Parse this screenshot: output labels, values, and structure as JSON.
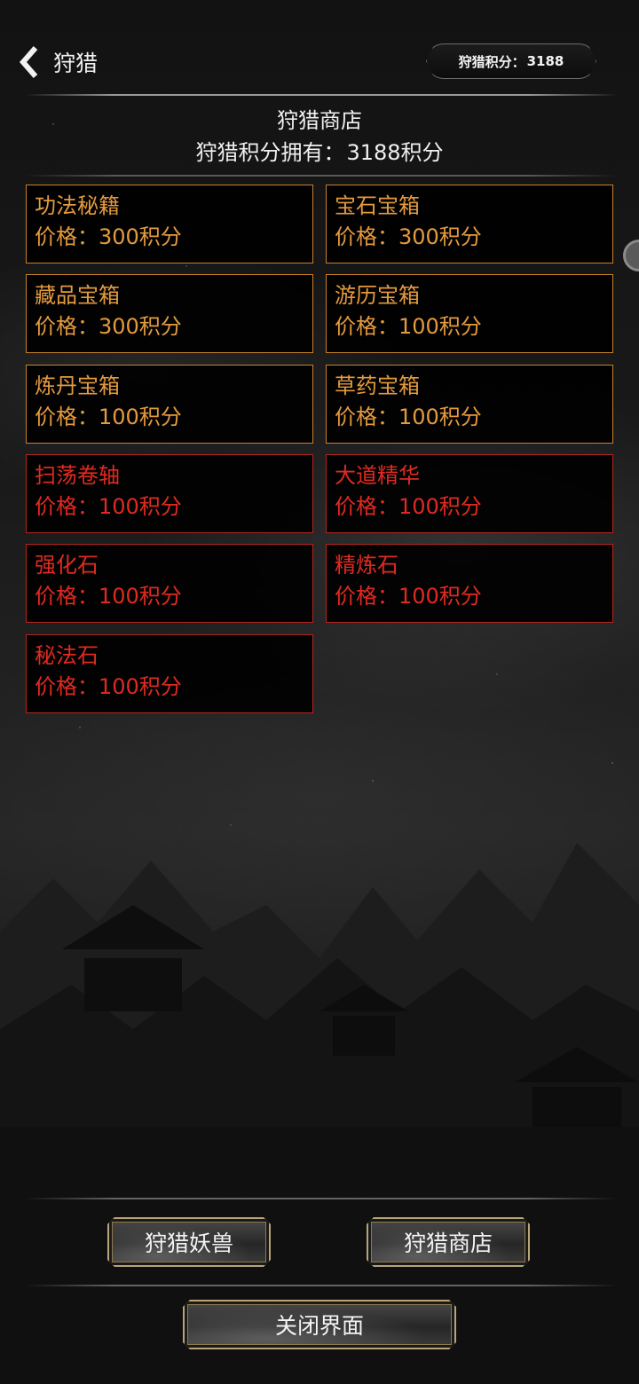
{
  "header": {
    "title": "狩猎",
    "score_label": "狩猎积分：",
    "score_value": "3188"
  },
  "shop": {
    "title": "狩猎商店",
    "points_label": "狩猎积分拥有：",
    "points_value": "3188积分"
  },
  "items": [
    {
      "name": "功法秘籍",
      "price": "价格：300积分",
      "color": "#e49a3e"
    },
    {
      "name": "宝石宝箱",
      "price": "价格：300积分",
      "color": "#e49a3e"
    },
    {
      "name": "藏品宝箱",
      "price": "价格：300积分",
      "color": "#e49a3e"
    },
    {
      "name": "游历宝箱",
      "price": "价格：100积分",
      "color": "#e49a3e"
    },
    {
      "name": "炼丹宝箱",
      "price": "价格：100积分",
      "color": "#e49a3e"
    },
    {
      "name": "草药宝箱",
      "price": "价格：100积分",
      "color": "#e49a3e"
    },
    {
      "name": "扫荡卷轴",
      "price": "价格：100积分",
      "color": "#e02a20"
    },
    {
      "name": "大道精华",
      "price": "价格：100积分",
      "color": "#e02a20"
    },
    {
      "name": "强化石",
      "price": "价格：100积分",
      "color": "#e02a20"
    },
    {
      "name": "精炼石",
      "price": "价格：100积分",
      "color": "#e02a20"
    },
    {
      "name": "秘法石",
      "price": "价格：100积分",
      "color": "#e02a20"
    }
  ],
  "buttons": {
    "hunt_monster": "狩猎妖兽",
    "hunt_shop": "狩猎商店",
    "close": "关闭界面"
  },
  "icons": {
    "back": "chevron-left-icon"
  }
}
